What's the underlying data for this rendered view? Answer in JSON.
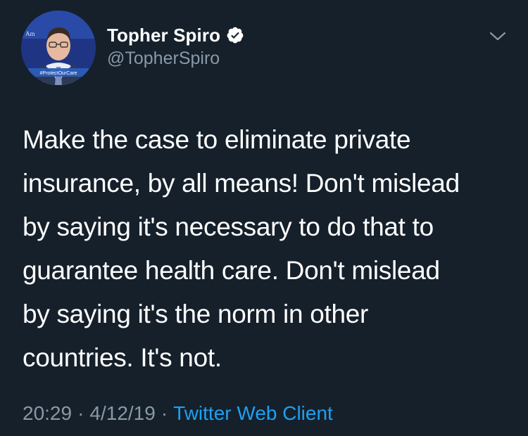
{
  "tweet": {
    "author": {
      "display_name": "Topher Spiro",
      "handle": "@TopherSpiro",
      "verified": true,
      "avatar_banner_text": "#ProtectOurCare",
      "avatar_top_text": "Am"
    },
    "text_lines": [
      "Make the case to eliminate private",
      "insurance, by all means! Don't mislead",
      "by saying it's necessary to do that to",
      "guarantee health care. Don't mislead",
      "by saying it's the norm in other",
      "countries. It's not."
    ],
    "time": "20:29",
    "date": "4/12/19",
    "separator": "·",
    "source": "Twitter Web Client"
  },
  "icons": {
    "verified": "verified-badge-icon",
    "menu": "chevron-down-icon"
  },
  "colors": {
    "background": "#15202b",
    "primary_text": "#ffffff",
    "secondary_text": "#8899a6",
    "link": "#1da1f2"
  }
}
